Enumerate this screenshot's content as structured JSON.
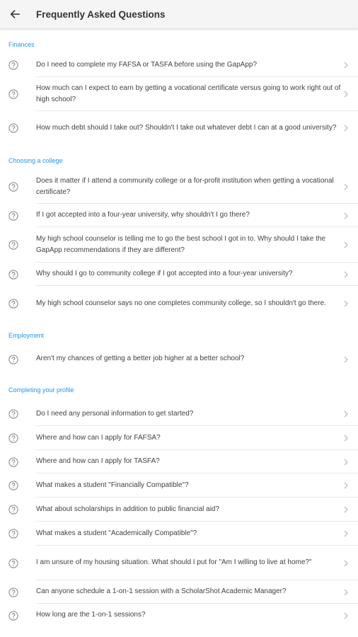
{
  "header": {
    "title": "Frequently Asked Questions",
    "back_icon": "arrow-back-icon"
  },
  "icons": {
    "question": "help-circle-icon",
    "chevron": "chevron-right-icon"
  },
  "colors": {
    "accent": "#2196f3",
    "text": "#424242",
    "icon": "#9e9e9e"
  },
  "sections": [
    {
      "title": "Finances",
      "items": [
        "Do I need to complete my FAFSA or TASFA before using the GapApp?",
        "How much can I expect to earn by getting a vocational certificate versus going to work right out of high school?",
        "How much debt should I take out? Shouldn't I take out whatever debt I can at a good university?"
      ]
    },
    {
      "title": "Choosing a college",
      "items": [
        "Does it matter if I attend a community college or a for-profit institution when getting a vocational certificate?",
        "If I got accepted into a four-year university, why shouldn't I go there?",
        "My high school counselor is telling me to go the best school I got in to. Why should I take the GapApp recommendations if they are different?",
        "Why should I go to community college if I got accepted into a four-year university?",
        "My high school counselor says no one completes community college, so I shouldn't go there."
      ]
    },
    {
      "title": "Employment",
      "items": [
        "Aren't my chances of getting a better job higher at a better school?"
      ]
    },
    {
      "title": "Completing your profile",
      "items": [
        "Do I need any personal information to get started?",
        "Where and how can I apply for FAFSA?",
        "Where and how can I apply for TASFA?",
        "What makes a student \"Financially Compatible\"?",
        "What about scholarships in addition to public financial aid?",
        "What makes a student \"Academically Compatible\"?",
        "I am unsure of my housing situation. What should I put for \"Am I willing to live at home?\"",
        "Can anyone schedule a 1-on-1 session with a ScholarShot Academic Manager?",
        "How long are the 1-on-1 sessions?"
      ]
    }
  ]
}
